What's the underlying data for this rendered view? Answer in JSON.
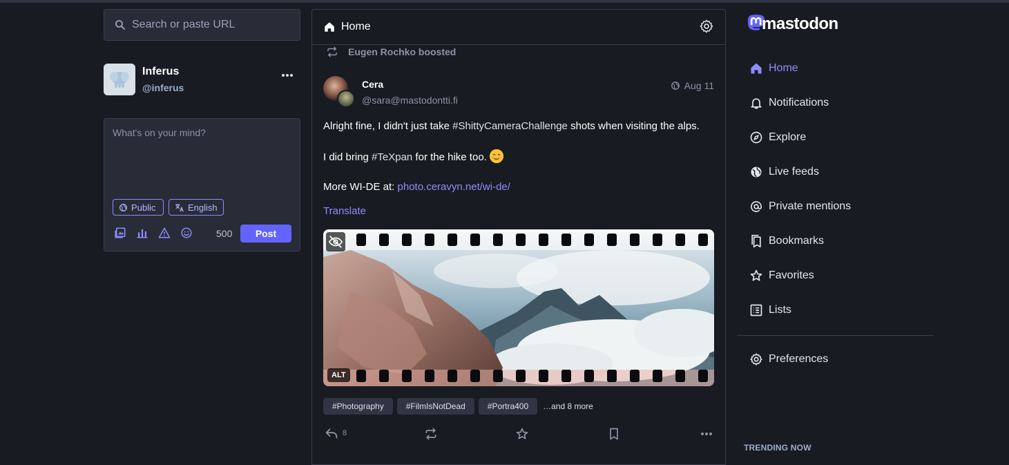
{
  "search": {
    "placeholder": "Search or paste URL"
  },
  "account": {
    "display_name": "Inferus",
    "handle": "@inferus"
  },
  "composer": {
    "placeholder": "What's on your mind?",
    "visibility": "Public",
    "language": "English",
    "char_count": "500",
    "post_label": "Post"
  },
  "column": {
    "title": "Home"
  },
  "status": {
    "boosted_by": "Eugen Rochko boosted",
    "author_name": "Cera",
    "author_handle": "@sara@mastodontti.fi",
    "date": "Aug 11",
    "paragraph1": {
      "before": "Alright fine, I didn't just take ",
      "tag": "#ShittyCameraChallenge",
      "after": " shots when visiting the alps."
    },
    "paragraph2": {
      "before": "I did bring ",
      "tag": "#TeXpan",
      "after": " for the hike too. "
    },
    "paragraph3": {
      "before": "More WI-DE at: ",
      "link": "photo.ceravyn.net/wi-de/"
    },
    "translate_label": "Translate",
    "alt_badge": "ALT",
    "hashtags": [
      "#Photography",
      "#FilmIsNotDead",
      "#Portra400"
    ],
    "more_tags": "…and 8 more",
    "reply_count": "8"
  },
  "nav": {
    "logo_text": "mastodon",
    "items": [
      {
        "label": "Home",
        "icon": "home-icon",
        "active": true
      },
      {
        "label": "Notifications",
        "icon": "bell-icon"
      },
      {
        "label": "Explore",
        "icon": "compass-icon"
      },
      {
        "label": "Live feeds",
        "icon": "globe-icon"
      },
      {
        "label": "Private mentions",
        "icon": "at-icon"
      },
      {
        "label": "Bookmarks",
        "icon": "bookmarks-icon"
      },
      {
        "label": "Favorites",
        "icon": "star-icon"
      },
      {
        "label": "Lists",
        "icon": "list-icon"
      },
      {
        "label": "Preferences",
        "icon": "gear-icon"
      }
    ],
    "trending_title": "TRENDING NOW"
  },
  "colors": {
    "accent": "#6364ff",
    "link": "#8c8dff",
    "background": "#191b22",
    "panel": "#282c37"
  }
}
